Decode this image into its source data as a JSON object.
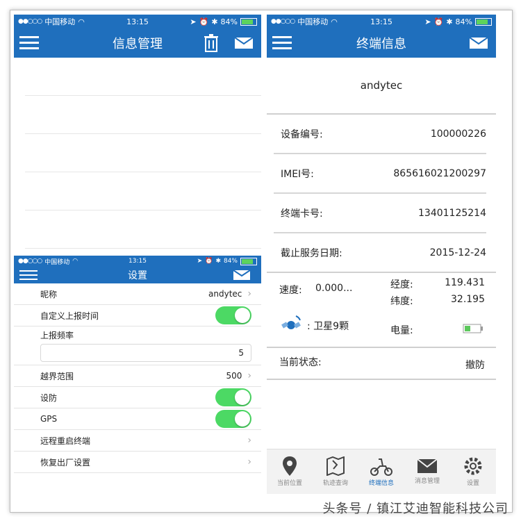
{
  "status": {
    "carrier": "中国移动",
    "time": "13:15",
    "battery": "84%"
  },
  "messages": {
    "title": "信息管理"
  },
  "settings": {
    "title": "设置",
    "rows": {
      "nickname_label": "昵称",
      "nickname_value": "andytec",
      "custom_report_label": "自定义上报时间",
      "frequency_label": "上报频率",
      "frequency_value": "5",
      "boundary_label": "越界范围",
      "boundary_value": "500",
      "defense_label": "设防",
      "gps_label": "GPS",
      "reboot_label": "远程重启终端",
      "factory_label": "恢复出厂设置"
    }
  },
  "terminal": {
    "title": "终端信息",
    "device_name": "andytec",
    "device_id_label": "设备编号:",
    "device_id_value": "100000226",
    "imei_label": "IMEI号:",
    "imei_value": "865616021200297",
    "card_label": "终端卡号:",
    "card_value": "13401125214",
    "expiry_label": "截止服务日期:",
    "expiry_value": "2015-12-24",
    "speed_label": "速度:",
    "speed_value": "0.000...",
    "lon_label": "经度:",
    "lon_value": "119.431",
    "lat_label": "纬度:",
    "lat_value": "32.195",
    "satellite_text": ": 卫星9颗",
    "power_label": "电量:",
    "state_label": "当前状态:",
    "state_value": "撤防"
  },
  "tabs": [
    {
      "label": "当前位置",
      "icon": "location-pin-icon"
    },
    {
      "label": "轨迹查询",
      "icon": "map-route-icon"
    },
    {
      "label": "终端信息",
      "icon": "scooter-icon",
      "active": true
    },
    {
      "label": "消息管理",
      "icon": "envelope-icon"
    },
    {
      "label": "设置",
      "icon": "gear-icon"
    }
  ],
  "watermark": "头条号 / 镇江艾迪智能科技公司",
  "colors": {
    "nav_blue": "#1f6fbd",
    "toggle_green": "#4cd964"
  }
}
